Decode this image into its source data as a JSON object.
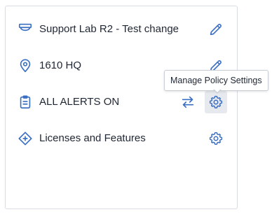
{
  "colors": {
    "accent": "#3a6fc4",
    "text": "#1f2633",
    "border": "#d9dde3",
    "active_bg": "#e6e9ee"
  },
  "rows": [
    {
      "icon": "camera-icon",
      "label": "Support Lab R2 - Test change",
      "actions": [
        "edit-icon"
      ]
    },
    {
      "icon": "location-pin-icon",
      "label": "1610 HQ",
      "actions": [
        "edit-icon"
      ]
    },
    {
      "icon": "clipboard-icon",
      "label": "ALL ALERTS ON",
      "actions": [
        "swap-arrows-icon",
        "gear-icon"
      ]
    },
    {
      "icon": "diamond-plus-icon",
      "label": "Licenses and Features",
      "actions": [
        "gear-icon"
      ]
    }
  ],
  "tooltip": {
    "text": "Manage Policy Settings"
  }
}
